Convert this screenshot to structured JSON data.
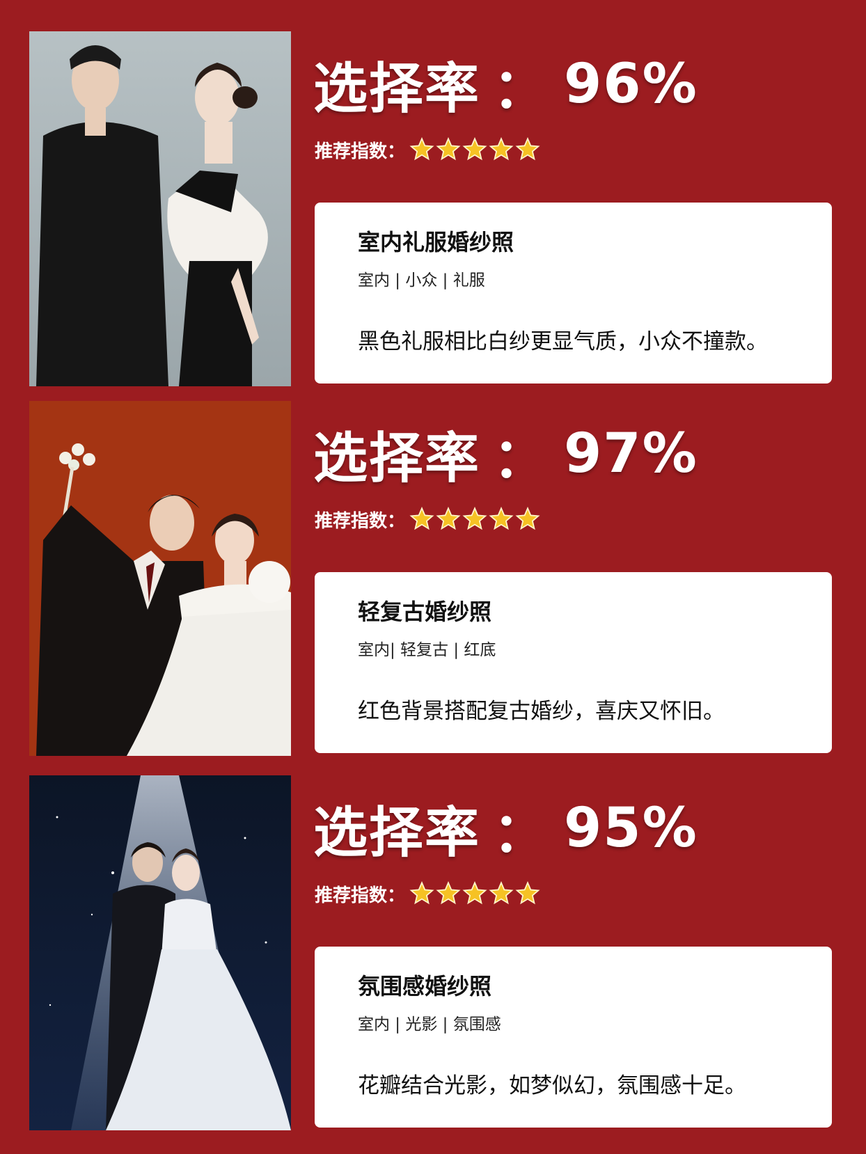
{
  "items": [
    {
      "rate_label": "选择率",
      "colon": "：",
      "rate_value": "96%",
      "rec_label": "推荐指数：",
      "stars": 5,
      "title": "室内礼服婚纱照",
      "tags": "室内 | 小众 | 礼服",
      "desc": "黑色礼服相比白纱更显气质，小众不撞款。"
    },
    {
      "rate_label": "选择率",
      "colon": "：",
      "rate_value": "97%",
      "rec_label": "推荐指数：",
      "stars": 5,
      "title": "轻复古婚纱照",
      "tags": "室内| 轻复古 | 红底",
      "desc": "红色背景搭配复古婚纱，喜庆又怀旧。"
    },
    {
      "rate_label": "选择率",
      "colon": "：",
      "rate_value": "95%",
      "rec_label": "推荐指数：",
      "stars": 5,
      "title": "氛围感婚纱照",
      "tags": "室内 | 光影 | 氛围感",
      "desc": "花瓣结合光影，如梦似幻，氛围感十足。"
    }
  ],
  "colors": {
    "background": "#9c1c20",
    "card": "#ffffff",
    "star": "#f6c224"
  }
}
